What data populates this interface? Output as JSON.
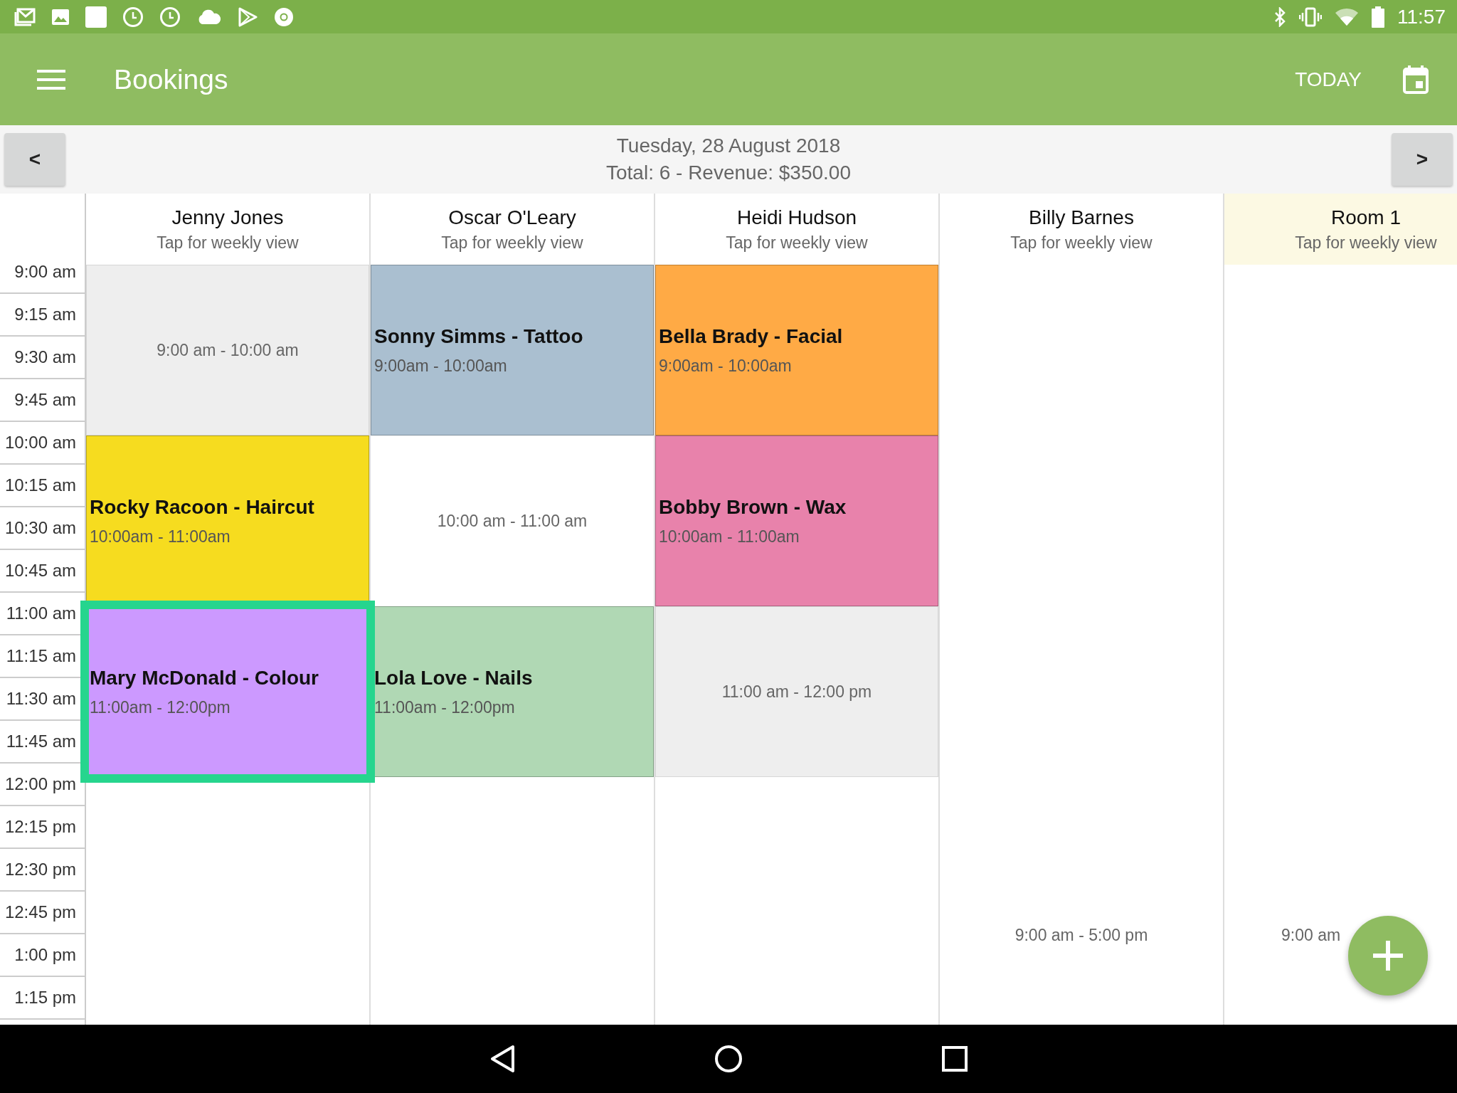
{
  "status_bar": {
    "time": "11:57"
  },
  "app_bar": {
    "title": "Bookings",
    "today_button": "TODAY"
  },
  "date_bar": {
    "prev": "<",
    "date": "Tuesday, 28 August 2018",
    "summary": "Total: 6 - Revenue: $350.00",
    "next": ">"
  },
  "times": [
    "9:00 am",
    "9:15 am",
    "9:30 am",
    "9:45 am",
    "10:00 am",
    "10:15 am",
    "10:30 am",
    "10:45 am",
    "11:00 am",
    "11:15 am",
    "11:30 am",
    "11:45 am",
    "12:00 pm",
    "12:15 pm",
    "12:30 pm",
    "12:45 pm",
    "1:00 pm",
    "1:15 pm"
  ],
  "columns": [
    {
      "name": "Jenny Jones",
      "subtitle": "Tap for weekly view",
      "kind": "staff",
      "blocks": [
        {
          "kind": "free",
          "time": "9:00 am - 10:00 am"
        },
        {
          "kind": "booking",
          "title": "Rocky Racoon - Haircut",
          "time": "10:00am - 11:00am",
          "color": "#f6dc1f",
          "selected": false
        },
        {
          "kind": "booking",
          "title": "Mary McDonald - Colour",
          "time": "11:00am - 12:00pm",
          "color": "#cc99ff",
          "selected": true
        }
      ]
    },
    {
      "name": "Oscar O'Leary",
      "subtitle": "Tap for weekly view",
      "kind": "staff",
      "blocks": [
        {
          "kind": "booking",
          "title": "Sonny Simms - Tattoo",
          "time": "9:00am - 10:00am",
          "color": "#aabfd0",
          "selected": false
        },
        {
          "kind": "open",
          "time": "10:00 am - 11:00 am"
        },
        {
          "kind": "booking",
          "title": "Lola Love - Nails",
          "time": "11:00am - 12:00pm",
          "color": "#b0d8b4",
          "selected": false
        }
      ]
    },
    {
      "name": "Heidi Hudson",
      "subtitle": "Tap for weekly view",
      "kind": "staff",
      "blocks": [
        {
          "kind": "booking",
          "title": "Bella Brady - Facial",
          "time": "9:00am - 10:00am",
          "color": "#ffaa45",
          "selected": false
        },
        {
          "kind": "booking",
          "title": "Bobby Brown - Wax",
          "time": "10:00am - 11:00am",
          "color": "#e882ab",
          "selected": false
        },
        {
          "kind": "free",
          "time": "11:00 am - 12:00 pm"
        }
      ]
    },
    {
      "name": "Billy Barnes",
      "subtitle": "Tap for weekly view",
      "kind": "staff",
      "blocks": [
        {
          "kind": "all-day",
          "time": "9:00 am - 5:00 pm"
        }
      ]
    },
    {
      "name": "Room 1",
      "subtitle": "Tap for weekly view",
      "kind": "room",
      "blocks": [
        {
          "kind": "all-day",
          "time": "9:00 am"
        }
      ]
    }
  ]
}
